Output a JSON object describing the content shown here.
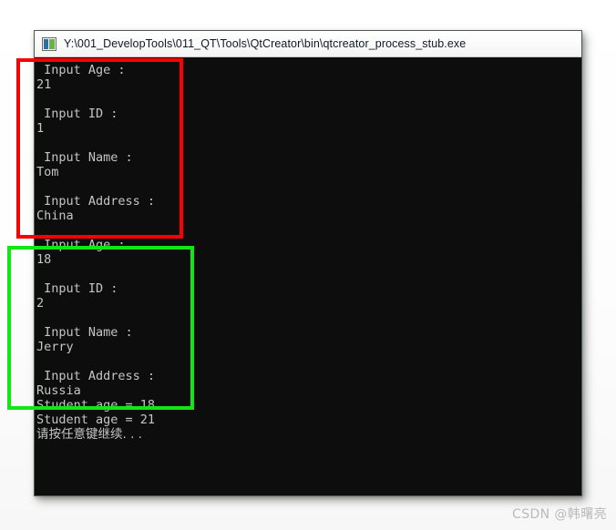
{
  "window": {
    "title": "Y:\\001_DevelopTools\\011_QT\\Tools\\QtCreator\\bin\\qtcreator_process_stub.exe",
    "icon": "console-app-icon",
    "background_color": "#0d0d0d",
    "text_color": "#c5c5c5"
  },
  "console": {
    "lines": [
      " Input Age : ",
      "21",
      "",
      " Input ID : ",
      "1",
      "",
      " Input Name : ",
      "Tom",
      "",
      " Input Address : ",
      "China",
      "",
      " Input Age : ",
      "18",
      "",
      " Input ID : ",
      "2",
      "",
      " Input Name : ",
      "Jerry",
      "",
      " Input Address : ",
      "Russia",
      "Student age = 18",
      "Student age = 21",
      "请按任意键继续. . ."
    ]
  },
  "annotations": [
    {
      "name": "first-student-input-block",
      "color": "#fb0000",
      "label": "red"
    },
    {
      "name": "second-student-input-block",
      "color": "#13e713",
      "label": "green"
    }
  ],
  "watermark": {
    "text": "CSDN @韩曙亮"
  }
}
